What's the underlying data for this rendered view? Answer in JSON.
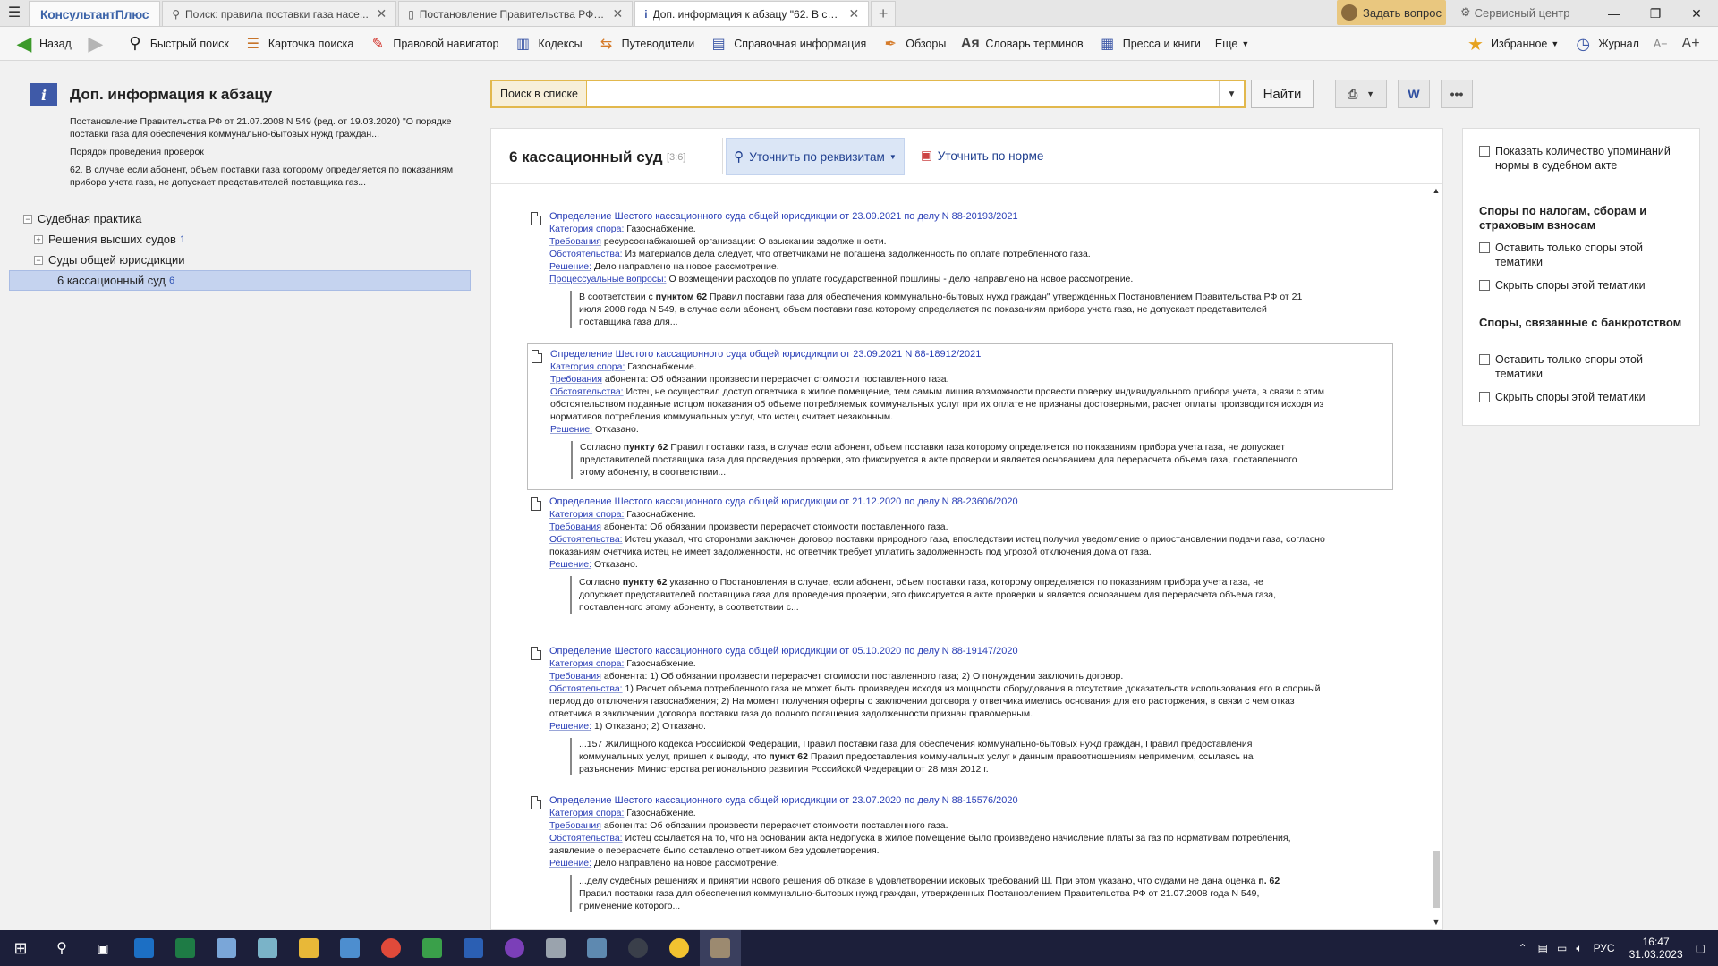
{
  "app": {
    "logo": "КонсультантПлюс"
  },
  "tabs": [
    {
      "text": "Поиск: правила поставки газа насе...",
      "active": false
    },
    {
      "text": "Постановление Правительства РФ о...",
      "active": false
    },
    {
      "text": "Доп. информация к абзацу \"62. В слу...",
      "active": true
    }
  ],
  "titlebar": {
    "ask": "Задать вопрос",
    "service": "Сервисный центр"
  },
  "toolbar": {
    "back": "Назад",
    "quick_search": "Быстрый поиск",
    "search_card": "Карточка поиска",
    "legal_nav": "Правовой навигатор",
    "codes": "Кодексы",
    "guides": "Путеводители",
    "reference": "Справочная информация",
    "reviews": "Обзоры",
    "dictionary": "Словарь терминов",
    "press": "Пресса и книги",
    "more": "Еще",
    "favorites": "Избранное",
    "journal": "Журнал",
    "font_minus": "A−",
    "font_plus": "A+"
  },
  "left": {
    "title": "Доп. информация к абзацу",
    "doc": "Постановление Правительства РФ от 21.07.2008 N 549 (ред. от 19.03.2020) \"О порядке поставки газа для обеспечения коммунально-бытовых нужд граждан...",
    "section": "Порядок проведения проверок",
    "paragraph": "62. В случае если абонент, объем поставки газа которому определяется по показаниям прибора учета газа, не допускает представителей поставщика газ...",
    "tree": [
      {
        "label": "Судебная практика",
        "count": ""
      },
      {
        "label": "Решения высших судов",
        "count": "1"
      },
      {
        "label": "Суды общей юрисдикции",
        "count": ""
      },
      {
        "label": "6 кассационный суд",
        "count": "6"
      }
    ]
  },
  "search": {
    "label": "Поиск в списке",
    "value": "",
    "find": "Найти"
  },
  "main": {
    "court": "6 кассационный суд",
    "range": "[3:6]",
    "refine_req": "Уточнить по реквизитам",
    "refine_norm": "Уточнить по норме"
  },
  "results": [
    {
      "title": "Определение Шестого кассационного суда общей юрисдикции от 23.09.2021 по делу N 88-20193/2021",
      "category": "Газоснабжение.",
      "requirements": "ресурсоснабжающей организации: О взыскании задолженности.",
      "circumstances": "Из материалов дела следует, что ответчиками не погашена задолженность по оплате потребленного газа.",
      "decision": "Дело направлено на новое рассмотрение.",
      "procedural": "О возмещении расходов по уплате государственной пошлины - дело направлено на новое рассмотрение.",
      "excerpt_pre": "В соответствии с ",
      "excerpt_bold": "пунктом 62",
      "excerpt_post": " Правил поставки газа для обеспечения коммунально-бытовых нужд граждан\" утвержденных Постановлением Правительства РФ от 21 июля 2008 года N 549, в случае если абонент, объем поставки газа которому определяется по показаниям прибора учета газа, не допускает представителей поставщика газа для..."
    },
    {
      "title": "Определение Шестого кассационного суда общей юрисдикции от 23.09.2021 N 88-18912/2021",
      "category": "Газоснабжение.",
      "requirements": "абонента: Об обязании произвести перерасчет стоимости поставленного газа.",
      "circumstances": "Истец не осуществил доступ ответчика в жилое помещение, тем самым лишив возможности провести поверку индивидуального прибора учета, в связи с этим обстоятельством поданные истцом показания об объеме потребляемых коммунальных услуг при их оплате не признаны достоверными, расчет оплаты производится исходя из нормативов потребления коммунальных услуг, что истец считает незаконным.",
      "decision": "Отказано.",
      "procedural": "",
      "excerpt_pre": "Согласно ",
      "excerpt_bold": "пункту 62",
      "excerpt_post": " Правил поставки газа, в случае если абонент, объем поставки газа которому определяется по показаниям прибора учета газа, не допускает представителей поставщика газа для проведения проверки, это фиксируется в акте проверки и является основанием для перерасчета объема газа, поставленного этому абоненту, в соответствии..."
    },
    {
      "title": "Определение Шестого кассационного суда общей юрисдикции от 21.12.2020 по делу N 88-23606/2020",
      "category": "Газоснабжение.",
      "requirements": "абонента: Об обязании произвести перерасчет стоимости поставленного газа.",
      "circumstances": "Истец указал, что сторонами заключен договор поставки природного газа, впоследствии истец получил уведомление о приостановлении подачи газа, согласно показаниям счетчика истец не имеет задолженности, но ответчик требует уплатить задолженность под угрозой отключения дома от газа.",
      "decision": "Отказано.",
      "procedural": "",
      "excerpt_pre": "Согласно ",
      "excerpt_bold": "пункту 62",
      "excerpt_post": " указанного Постановления в случае, если абонент, объем поставки газа, которому определяется по показаниям прибора учета газа, не допускает представителей поставщика газа для проведения проверки, это фиксируется в акте проверки и является основанием для перерасчета объема газа, поставленного этому абоненту, в соответствии с..."
    },
    {
      "title": "Определение Шестого кассационного суда общей юрисдикции от 05.10.2020 по делу N 88-19147/2020",
      "category": "Газоснабжение.",
      "requirements": "абонента: 1) Об обязании произвести перерасчет стоимости поставленного газа; 2) О понуждении заключить договор.",
      "circumstances": "1) Расчет объема потребленного газа не может быть произведен исходя из мощности оборудования в отсутствие доказательств использования его в спорный период до отключения газоснабжения; 2) На момент получения оферты о заключении договора у ответчика имелись основания для его расторжения, в связи с чем отказ ответчика в заключении договора поставки газа до полного погашения задолженности признан правомерным.",
      "decision": "1) Отказано; 2) Отказано.",
      "procedural": "",
      "excerpt_pre": "...157 Жилищного кодекса Российской Федерации, Правил поставки газа для обеспечения коммунально-бытовых нужд граждан, Правил предоставления коммунальных услуг, пришел к выводу, что ",
      "excerpt_bold": "пункт 62",
      "excerpt_post": " Правил предоставления коммунальных услуг к данным правоотношениям неприменим, ссылаясь на разъяснения Министерства регионального развития Российской Федерации от 28 мая 2012 г."
    },
    {
      "title": "Определение Шестого кассационного суда общей юрисдикции от 23.07.2020 по делу N 88-15576/2020",
      "category": "Газоснабжение.",
      "requirements": "абонента: Об обязании произвести перерасчет стоимости поставленного газа.",
      "circumstances": "Истец ссылается на то, что на основании акта недопуска в жилое помещение было произведено начисление платы за газ по нормативам потребления, заявление о перерасчете было оставлено ответчиком без удовлетворения.",
      "decision": "Дело направлено на новое рассмотрение.",
      "procedural": "",
      "excerpt_pre": "...делу судебных решениях и принятии нового решения об отказе в удовлетворении исковых требований Ш. При этом указано, что судами не дана оценка ",
      "excerpt_bold": "п. 62",
      "excerpt_post": " Правил поставки газа для обеспечения коммунально-бытовых нужд граждан, утвержденных Постановлением Правительства РФ от 21.07.2008 года N 549, применение которого..."
    }
  ],
  "labels": {
    "category": "Категория спора:",
    "requirements": "Требования",
    "circumstances": "Обстоятельства:",
    "decision": "Решение:",
    "procedural": "Процессуальные вопросы:"
  },
  "right": {
    "show_count": "Показать количество упоминаний нормы в судебном акте",
    "tax_header": "Споры по налогам, сборам и страховым взносам",
    "tax_only": "Оставить только споры этой тематики",
    "tax_hide": "Скрыть споры этой тематики",
    "bankrupt_header": "Споры, связанные с банкротством",
    "bankrupt_only": "Оставить только споры этой тематики",
    "bankrupt_hide": "Скрыть споры этой тематики"
  },
  "tray": {
    "lang": "РУС",
    "time": "16:47",
    "date": "31.03.2023"
  },
  "colors": {
    "accent": "#2a3fb7",
    "search_border": "#e2b84d",
    "selected": "#c5d3ef",
    "taskbar": "#1c1f3a"
  }
}
